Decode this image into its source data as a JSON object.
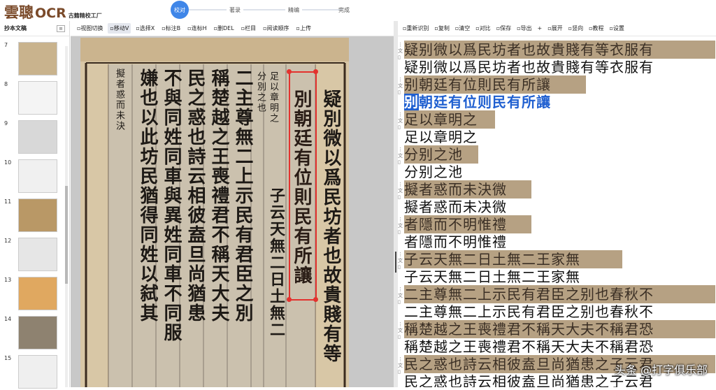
{
  "app": {
    "logo_cn": "雲聰",
    "logo_en": "OCR",
    "logo_sub": "古籍精校工厂"
  },
  "steps": [
    {
      "label": "校对",
      "active": true
    },
    {
      "label": "著录",
      "active": false
    },
    {
      "label": "精编",
      "active": false
    },
    {
      "label": "完成",
      "active": false
    }
  ],
  "left_panel": {
    "title": "抄本文稿",
    "thumbnails": [
      {
        "num": "7",
        "tone": "#c9b38d"
      },
      {
        "num": "8",
        "tone": "#f4f4f4"
      },
      {
        "num": "9",
        "tone": "#d8d8d8"
      },
      {
        "num": "10",
        "tone": "#f0f0f0"
      },
      {
        "num": "11",
        "tone": "#b99866"
      },
      {
        "num": "12",
        "tone": "#e6e6e6"
      },
      {
        "num": "13",
        "tone": "#e0a860"
      },
      {
        "num": "14",
        "tone": "#8e8270"
      },
      {
        "num": "15",
        "tone": "#efefef"
      }
    ]
  },
  "mid_toolbar": [
    {
      "icon": "split-view-icon",
      "label": "视图切换",
      "on": false
    },
    {
      "icon": "move-icon",
      "label": "移动V",
      "on": true
    },
    {
      "icon": "select-icon",
      "label": "选择X",
      "on": false
    },
    {
      "icon": "mark-icon",
      "label": "标注B",
      "on": false
    },
    {
      "icon": "link-mark-icon",
      "label": "连标H",
      "on": false
    },
    {
      "icon": "delete-icon",
      "label": "删DEL",
      "on": false
    },
    {
      "icon": "column-icon",
      "label": "栏目",
      "on": false
    },
    {
      "icon": "reading-order-icon",
      "label": "阅读顺序",
      "on": false
    },
    {
      "icon": "upload-icon",
      "label": "上传",
      "on": false
    }
  ],
  "right_toolbar": [
    {
      "icon": "re-recognize-icon",
      "label": "重新识别"
    },
    {
      "icon": "copy-icon",
      "label": "复制"
    },
    {
      "icon": "clear-icon",
      "label": "清空"
    },
    {
      "icon": "compare-icon",
      "label": "对比"
    },
    {
      "icon": "save-icon",
      "label": "保存"
    },
    {
      "icon": "export-icon",
      "label": "导出"
    },
    {
      "icon": "plus-icon",
      "label": "+"
    },
    {
      "icon": "expand-icon",
      "label": "展开"
    },
    {
      "icon": "vertical-icon",
      "label": "竖向"
    },
    {
      "icon": "tutorial-icon",
      "label": "教程"
    },
    {
      "icon": "settings-icon",
      "label": "设置"
    }
  ],
  "scan_columns": [
    "疑別微以爲民坊者也故貴賤有等",
    "別朝廷有位則民有所讓",
    "足以章明之",
    "分別之也",
    "二主尊無二上示民有君臣之別",
    "稱楚越之王喪禮君不稱天大夫",
    "民之惑也詩云相彼盍旦尚猶患",
    "不與同姓同車與異姓同車不同服",
    "嫌也以此坊民猶得同姓以弑其",
    "子云天無二日土無二",
    "擬者惑而未決"
  ],
  "text_lines": [
    {
      "image": "疑别微以爲民坊者也故貴賤有等衣服有",
      "text": "疑别微以爲民坊者也故貴賤有等衣服有",
      "width": 445,
      "active": false
    },
    {
      "image": "别朝廷有位則民有所讓",
      "text": "朝廷有位则民有所讓",
      "cursor_char": "别",
      "width": 260,
      "active": true
    },
    {
      "image": "足以章明之",
      "text": "足以章明之",
      "width": 130,
      "active": false
    },
    {
      "image": "分别之池",
      "text": "分别之池",
      "width": 106,
      "active": false
    },
    {
      "image": "擬者惑而未決微",
      "text": "擬者惑而未决微",
      "width": 182,
      "active": false
    },
    {
      "image": "者隱而不明惟禮",
      "text": "者隱而不明惟禮",
      "width": 182,
      "active": false
    },
    {
      "image": "子云天無二日土無二王家無",
      "text": "子云天無二日土無二王家無",
      "width": 312,
      "active": false
    },
    {
      "image": "二主尊無二上示民有君臣之别也春秋不",
      "text": "二主尊無二上示民有君臣之别也春秋不",
      "width": 445,
      "active": false
    },
    {
      "image": "稱楚越之王喪禮君不稱天大夫不稱君恐",
      "text": "稱楚越之王喪禮君不稱天大夫不稱君恐",
      "width": 445,
      "active": false
    },
    {
      "image": "民之惑也詩云相彼盍旦尚猶患之子云君",
      "text": "民之惑也詩云相彼盍旦尚猶患之子云君",
      "width": 445,
      "active": false
    }
  ],
  "watermark": "头条 @打字俱乐部"
}
